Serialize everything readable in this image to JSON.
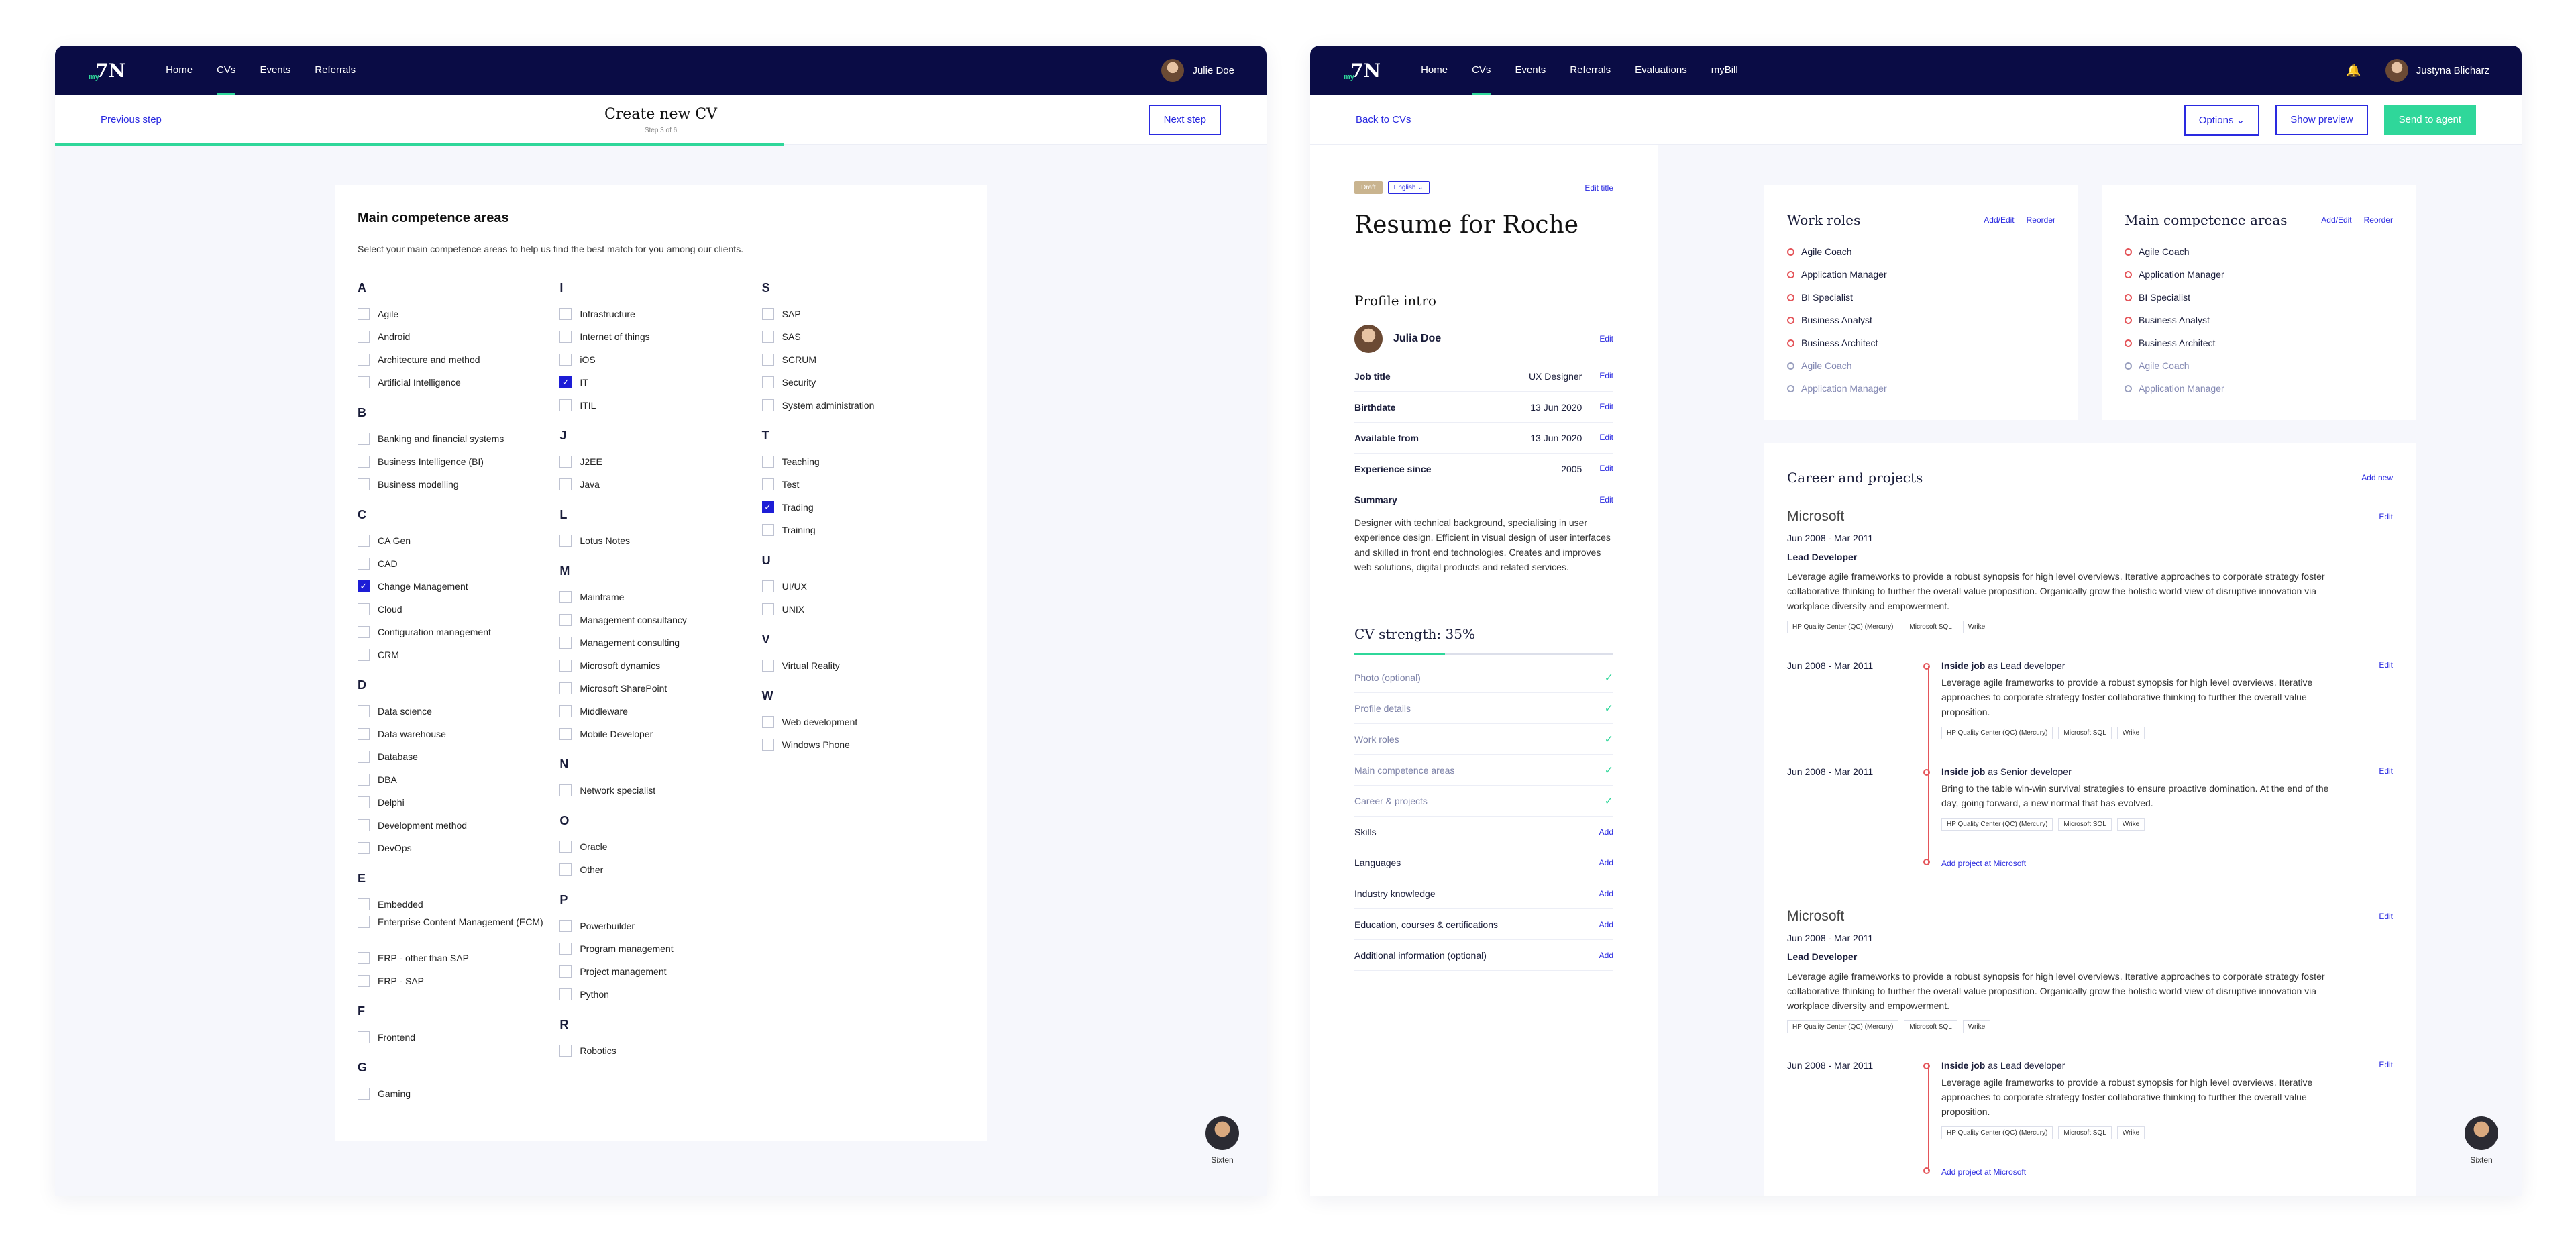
{
  "left": {
    "nav": {
      "logo": "7N",
      "logo_sub": "my",
      "links": [
        "Home",
        "CVs",
        "Events",
        "Referrals"
      ],
      "user": "Julie Doe"
    },
    "sub": {
      "prev": "Previous step",
      "title": "Create new CV",
      "step": "Step 3 of 6",
      "next": "Next step"
    },
    "card": {
      "title": "Main competence areas",
      "intro": "Select your main competence areas to help us find the best match for you among our clients.",
      "columns": [
        [
          {
            "letter": "A",
            "items": [
              {
                "l": "Agile"
              },
              {
                "l": "Android"
              },
              {
                "l": "Architecture and method"
              },
              {
                "l": "Artificial Intelligence"
              }
            ]
          },
          {
            "letter": "B",
            "items": [
              {
                "l": "Banking and financial systems"
              },
              {
                "l": "Business Intelligence (BI)"
              },
              {
                "l": "Business modelling"
              }
            ]
          },
          {
            "letter": "C",
            "items": [
              {
                "l": "CA Gen"
              },
              {
                "l": "CAD"
              },
              {
                "l": "Change Management",
                "c": true
              },
              {
                "l": "Cloud"
              },
              {
                "l": "Configuration management"
              },
              {
                "l": "CRM"
              }
            ]
          },
          {
            "letter": "D",
            "items": [
              {
                "l": "Data science"
              },
              {
                "l": "Data warehouse"
              },
              {
                "l": "Database"
              },
              {
                "l": "DBA"
              },
              {
                "l": "Delphi"
              },
              {
                "l": "Development method"
              },
              {
                "l": "DevOps"
              }
            ]
          },
          {
            "letter": "E",
            "items": [
              {
                "l": "Embedded"
              },
              {
                "l": "Enterprise Content Management (ECM)"
              },
              {
                "l": "ERP - other than SAP"
              },
              {
                "l": "ERP - SAP"
              }
            ]
          },
          {
            "letter": "F",
            "items": [
              {
                "l": "Frontend"
              }
            ]
          },
          {
            "letter": "G",
            "items": [
              {
                "l": "Gaming"
              }
            ]
          }
        ],
        [
          {
            "letter": "I",
            "items": [
              {
                "l": "Infrastructure"
              },
              {
                "l": "Internet of things"
              },
              {
                "l": "iOS"
              },
              {
                "l": "IT",
                "c": true
              },
              {
                "l": "ITIL"
              }
            ]
          },
          {
            "letter": "J",
            "items": [
              {
                "l": "J2EE"
              },
              {
                "l": "Java"
              }
            ]
          },
          {
            "letter": "L",
            "items": [
              {
                "l": "Lotus Notes"
              }
            ]
          },
          {
            "letter": "M",
            "items": [
              {
                "l": "Mainframe"
              },
              {
                "l": "Management consultancy"
              },
              {
                "l": "Management consulting"
              },
              {
                "l": "Microsoft dynamics"
              },
              {
                "l": "Microsoft SharePoint"
              },
              {
                "l": "Middleware"
              },
              {
                "l": "Mobile Developer"
              }
            ]
          },
          {
            "letter": "N",
            "items": [
              {
                "l": "Network specialist"
              }
            ]
          },
          {
            "letter": "O",
            "items": [
              {
                "l": "Oracle"
              },
              {
                "l": "Other"
              }
            ]
          },
          {
            "letter": "P",
            "items": [
              {
                "l": "Powerbuilder"
              },
              {
                "l": "Program management"
              },
              {
                "l": "Project management"
              },
              {
                "l": "Python"
              }
            ]
          },
          {
            "letter": "R",
            "items": [
              {
                "l": "Robotics"
              }
            ]
          }
        ],
        [
          {
            "letter": "S",
            "items": [
              {
                "l": "SAP"
              },
              {
                "l": "SAS"
              },
              {
                "l": "SCRUM"
              },
              {
                "l": "Security"
              },
              {
                "l": "System administration"
              }
            ]
          },
          {
            "letter": "T",
            "items": [
              {
                "l": "Teaching"
              },
              {
                "l": "Test"
              },
              {
                "l": "Trading",
                "c": true
              },
              {
                "l": "Training"
              }
            ]
          },
          {
            "letter": "U",
            "items": [
              {
                "l": "UI/UX"
              },
              {
                "l": "UNIX"
              }
            ]
          },
          {
            "letter": "V",
            "items": [
              {
                "l": "Virtual Reality"
              }
            ]
          },
          {
            "letter": "W",
            "items": [
              {
                "l": "Web development"
              },
              {
                "l": "Windows Phone"
              }
            ]
          }
        ]
      ]
    },
    "assistant": "Sixten"
  },
  "right": {
    "nav": {
      "logo": "7N",
      "logo_sub": "my",
      "links": [
        "Home",
        "CVs",
        "Events",
        "Referrals",
        "Evaluations",
        "myBill"
      ],
      "user": "Justyna Blicharz"
    },
    "sub": {
      "back": "Back to CVs",
      "options": "Options",
      "preview": "Show preview",
      "send": "Send to agent"
    },
    "resume": {
      "badge": "Draft",
      "lang": "English",
      "edit_title": "Edit title",
      "title": "Resume for Roche",
      "profile_heading": "Profile intro",
      "name": "Julia Doe",
      "edit": "Edit",
      "fields": [
        {
          "k": "Job title",
          "v": "UX Designer"
        },
        {
          "k": "Birthdate",
          "v": "13 Jun 2020"
        },
        {
          "k": "Available from",
          "v": "13 Jun 2020"
        },
        {
          "k": "Experience since",
          "v": "2005"
        }
      ],
      "summary_label": "Summary",
      "summary": "Designer with technical background, specialising in user experience design. Efficient in visual design of user interfaces and skilled in front end technologies. Creates and improves web solutions, digital products and related services.",
      "strength": "CV strength: 35%",
      "strength_value": 35,
      "checklist": [
        {
          "l": "Photo (optional)",
          "done": true
        },
        {
          "l": "Profile details",
          "done": true
        },
        {
          "l": "Work roles",
          "done": true
        },
        {
          "l": "Main competence areas",
          "done": true
        },
        {
          "l": "Career & projects",
          "done": true
        },
        {
          "l": "Skills",
          "a": "Add"
        },
        {
          "l": "Languages",
          "a": "Add"
        },
        {
          "l": "Industry knowledge",
          "a": "Add"
        },
        {
          "l": "Education, courses & certifications",
          "a": "Add"
        },
        {
          "l": "Additional information (optional)",
          "a": "Add"
        }
      ]
    },
    "work_roles": {
      "title": "Work roles",
      "addedit": "Add/Edit",
      "reorder": "Reorder"
    },
    "competence": {
      "title": "Main competence areas",
      "addedit": "Add/Edit",
      "reorder": "Reorder"
    },
    "roles": [
      {
        "l": "Agile Coach"
      },
      {
        "l": "Application Manager"
      },
      {
        "l": "BI Specialist"
      },
      {
        "l": "Business Analyst"
      },
      {
        "l": "Business Architect"
      },
      {
        "l": "Agile Coach",
        "g": true
      },
      {
        "l": "Application Manager",
        "g": true
      }
    ],
    "career": {
      "title": "Career and projects",
      "add": "Add new",
      "companies": [
        {
          "name": "Microsoft",
          "dates": "Jun 2008 - Mar 2011",
          "role": "Lead Developer",
          "desc": "Leverage agile frameworks to provide a robust synopsis for high level overviews. Iterative approaches to corporate strategy foster collaborative thinking to further the overall value proposition. Organically grow the holistic world view of disruptive innovation via workplace diversity and empowerment.",
          "tags": [
            "HP Quality Center (QC) (Mercury)",
            "Microsoft SQL",
            "Wrike"
          ],
          "jobs": [
            {
              "dates": "Jun 2008 - Mar 2011",
              "title": "Inside job",
              "as": "as Lead developer",
              "desc": "Leverage agile frameworks to provide a robust synopsis for high level overviews. Iterative approaches to corporate strategy foster collaborative thinking to further the overall value proposition.",
              "tags": [
                "HP Quality Center (QC) (Mercury)",
                "Microsoft SQL",
                "Wrike"
              ]
            },
            {
              "dates": "Jun 2008 - Mar 2011",
              "title": "Inside job",
              "as": "as Senior developer",
              "desc": "Bring to the table win-win survival strategies to ensure proactive domination. At the end of the day, going forward, a new normal that has evolved.",
              "tags": [
                "HP Quality Center (QC) (Mercury)",
                "Microsoft SQL",
                "Wrike"
              ]
            }
          ],
          "add_project": "Add project at Microsoft"
        },
        {
          "name": "Microsoft",
          "dates": "Jun 2008 - Mar 2011",
          "role": "Lead Developer",
          "desc": "Leverage agile frameworks to provide a robust synopsis for high level overviews. Iterative approaches to corporate strategy foster collaborative thinking to further the overall value proposition. Organically grow the holistic world view of disruptive innovation via workplace diversity and empowerment.",
          "tags": [
            "HP Quality Center (QC) (Mercury)",
            "Microsoft SQL",
            "Wrike"
          ],
          "jobs": [
            {
              "dates": "Jun 2008 - Mar 2011",
              "title": "Inside job",
              "as": "as Lead developer",
              "desc": "Leverage agile frameworks to provide a robust synopsis for high level overviews. Iterative approaches to corporate strategy foster collaborative thinking to further the overall value proposition.",
              "tags": [
                "HP Quality Center (QC) (Mercury)",
                "Microsoft SQL",
                "Wrike"
              ]
            }
          ],
          "add_project": "Add project at Microsoft"
        }
      ]
    },
    "assistant": "Sixten"
  },
  "colors": {
    "navy": "#0a0c45",
    "accent": "#2a2ae0",
    "green": "#2fd79a",
    "red": "#e4555a"
  }
}
